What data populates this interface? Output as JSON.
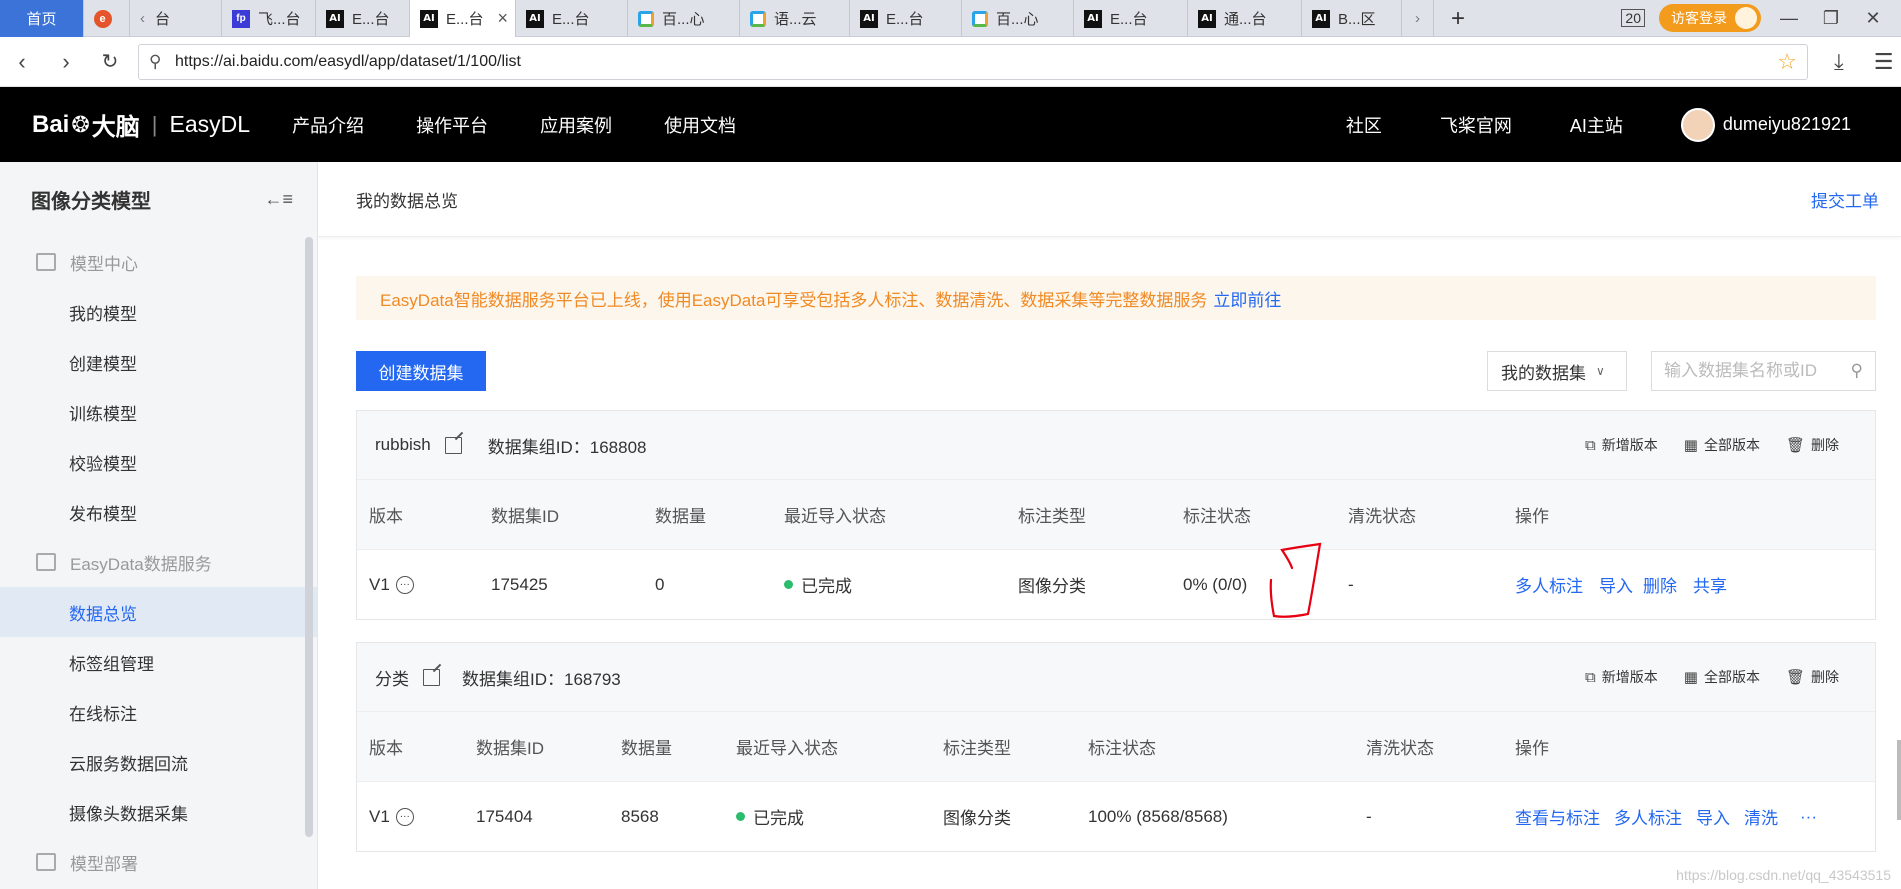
{
  "browser": {
    "tabs": [
      {
        "label": "首页",
        "icon": "home"
      },
      {
        "label": "",
        "icon": "red-app-icon"
      },
      {
        "label": "台",
        "icon": "back-chevron-icon"
      },
      {
        "label": "飞...台",
        "icon": "paddle-icon"
      },
      {
        "label": "E...台",
        "icon": "ai-icon"
      },
      {
        "label": "E...台",
        "icon": "ai-icon",
        "active": true
      },
      {
        "label": "E...台",
        "icon": "ai-icon"
      },
      {
        "label": "百...心",
        "icon": "baidu-cloud-icon"
      },
      {
        "label": "语...云",
        "icon": "baidu-cloud-icon"
      },
      {
        "label": "E...台",
        "icon": "ai-icon"
      },
      {
        "label": "百...心",
        "icon": "baidu-cloud-icon"
      },
      {
        "label": "E...台",
        "icon": "ai-icon"
      },
      {
        "label": "通...台",
        "icon": "ai-icon"
      },
      {
        "label": "B...区",
        "icon": "ai-icon"
      }
    ],
    "visitor_login": "访客登录",
    "url": "https://ai.baidu.com/easydl/app/dataset/1/100/list"
  },
  "site": {
    "logo_text": "Bai",
    "logo_text2": "大脑",
    "product": "EasyDL",
    "nav": [
      "产品介绍",
      "操作平台",
      "应用案例",
      "使用文档"
    ],
    "right_nav": [
      "社区",
      "飞桨官网",
      "AI主站"
    ],
    "username": "dumeiyu821921"
  },
  "sidebar": {
    "title": "图像分类模型",
    "groups": [
      {
        "label": "模型中心",
        "items": [
          "我的模型",
          "创建模型",
          "训练模型",
          "校验模型",
          "发布模型"
        ]
      },
      {
        "label": "EasyData数据服务",
        "items": [
          "数据总览",
          "标签组管理",
          "在线标注",
          "云服务数据回流",
          "摄像头数据采集"
        ]
      },
      {
        "label": "模型部署",
        "items": []
      }
    ],
    "active_item": "数据总览"
  },
  "main": {
    "breadcrumb": "我的数据总览",
    "submit_ticket": "提交工单",
    "notice_text": "EasyData智能数据服务平台已上线，使用EasyData可享受包括多人标注、数据清洗、数据采集等完整数据服务",
    "notice_link": "立即前往",
    "create_button": "创建数据集",
    "filter_select": "我的数据集",
    "search_placeholder": "输入数据集名称或ID",
    "group_actions": [
      "新增版本",
      "全部版本",
      "删除"
    ],
    "datasets": [
      {
        "name": "rubbish",
        "group_id_label": "数据集组ID：168808",
        "headers": [
          "版本",
          "数据集ID",
          "数据量",
          "最近导入状态",
          "标注类型",
          "标注状态",
          "清洗状态",
          "操作"
        ],
        "rows": [
          {
            "version": "V1",
            "id": "175425",
            "count": "0",
            "import_status": "已完成",
            "label_type": "图像分类",
            "label_status": "0% (0/0)",
            "clean_status": "-",
            "ops": [
              "多人标注",
              "导入",
              "删除",
              "共享"
            ]
          }
        ]
      },
      {
        "name": "分类",
        "group_id_label": "数据集组ID：168793",
        "headers": [
          "版本",
          "数据集ID",
          "数据量",
          "最近导入状态",
          "标注类型",
          "标注状态",
          "清洗状态",
          "操作"
        ],
        "rows": [
          {
            "version": "V1",
            "id": "175404",
            "count": "8568",
            "import_status": "已完成",
            "label_type": "图像分类",
            "label_status": "100% (8568/8568)",
            "clean_status": "-",
            "ops": [
              "查看与标注",
              "多人标注",
              "导入",
              "清洗",
              "···"
            ]
          }
        ]
      }
    ],
    "watermark": "https://blog.csdn.net/qq_43543515"
  },
  "colors": {
    "accent": "#2468f2",
    "notice": "#f08a24",
    "success": "#2bbd6d",
    "header_bg": "#000000",
    "annotation": "#e60012"
  }
}
